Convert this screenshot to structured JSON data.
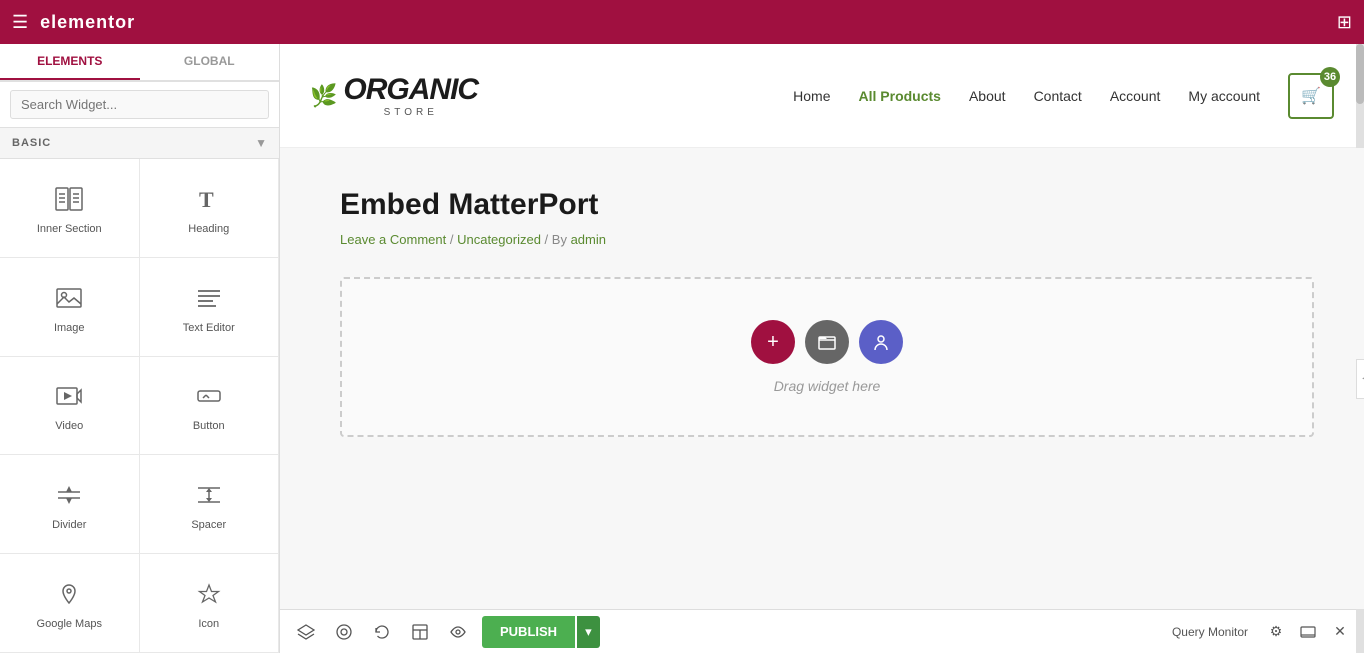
{
  "topbar": {
    "logo": "elementor",
    "hamburger": "☰",
    "grid": "⊞"
  },
  "sidebar": {
    "tabs": [
      {
        "id": "elements",
        "label": "ELEMENTS",
        "active": true
      },
      {
        "id": "global",
        "label": "GLOBAL",
        "active": false
      }
    ],
    "search_placeholder": "Search Widget...",
    "section_label": "BASIC",
    "widgets": [
      {
        "id": "inner-section",
        "label": "Inner Section",
        "icon": "inner-section-icon"
      },
      {
        "id": "heading",
        "label": "Heading",
        "icon": "heading-icon"
      },
      {
        "id": "image",
        "label": "Image",
        "icon": "image-icon"
      },
      {
        "id": "text-editor",
        "label": "Text Editor",
        "icon": "text-editor-icon"
      },
      {
        "id": "video",
        "label": "Video",
        "icon": "video-icon"
      },
      {
        "id": "button",
        "label": "Button",
        "icon": "button-icon"
      },
      {
        "id": "divider",
        "label": "Divider",
        "icon": "divider-icon"
      },
      {
        "id": "spacer",
        "label": "Spacer",
        "icon": "spacer-icon"
      },
      {
        "id": "google-maps",
        "label": "Google Maps",
        "icon": "google-maps-icon"
      },
      {
        "id": "icon",
        "label": "Icon",
        "icon": "icon-icon"
      }
    ]
  },
  "store": {
    "logo_main": "ORGANIC",
    "logo_sub": "STORE",
    "nav_links": [
      {
        "id": "home",
        "label": "Home",
        "active": false
      },
      {
        "id": "all-products",
        "label": "All Products",
        "active": true
      },
      {
        "id": "about",
        "label": "About",
        "active": false
      },
      {
        "id": "contact",
        "label": "Contact",
        "active": false
      },
      {
        "id": "account",
        "label": "Account",
        "active": false
      },
      {
        "id": "my-account",
        "label": "My account",
        "active": false
      },
      {
        "id": "cart",
        "label": "Cart",
        "active": false
      }
    ],
    "cart_count": "36"
  },
  "page": {
    "title": "Embed MatterPort",
    "meta_leave": "Leave a Comment",
    "meta_sep1": "/",
    "meta_category": "Uncategorized",
    "meta_sep2": "/",
    "meta_by": "By",
    "meta_author": "admin",
    "drop_text": "Drag widget here"
  },
  "bottom_bar": {
    "query_monitor": "Query Monitor",
    "publish_label": "PUBLISH",
    "publish_arrow": "▾"
  }
}
